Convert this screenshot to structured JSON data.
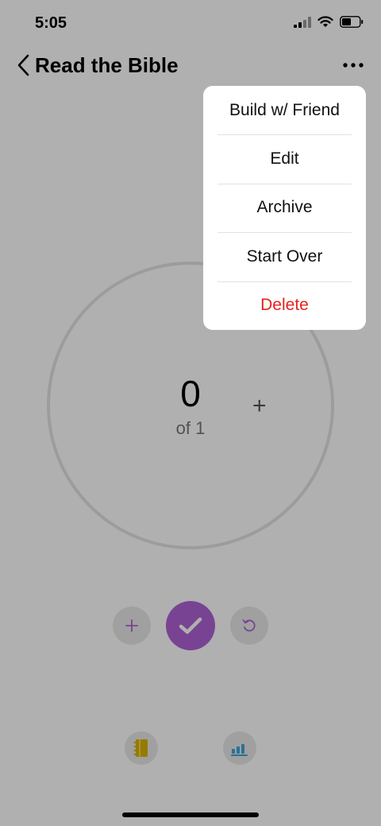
{
  "status_bar": {
    "time": "5:05"
  },
  "nav": {
    "title": "Read the Bible"
  },
  "progress": {
    "count": "0",
    "of_label": "of 1",
    "fraction": 0,
    "plus_label": "+"
  },
  "colors": {
    "accent": "#b062d6",
    "danger": "#e5211e",
    "journal": "#d9b300",
    "stats": "#3aa6d8"
  },
  "menu": {
    "items": [
      {
        "label": "Build w/ Friend"
      },
      {
        "label": "Edit"
      },
      {
        "label": "Archive"
      },
      {
        "label": "Start Over"
      },
      {
        "label": "Delete"
      }
    ]
  },
  "icons": {
    "back": "chevron-left-icon",
    "more": "ellipsis-icon",
    "add": "plus-icon",
    "complete": "checkmark-icon",
    "undo": "undo-icon",
    "journal": "notebook-icon",
    "stats": "bar-chart-icon"
  }
}
